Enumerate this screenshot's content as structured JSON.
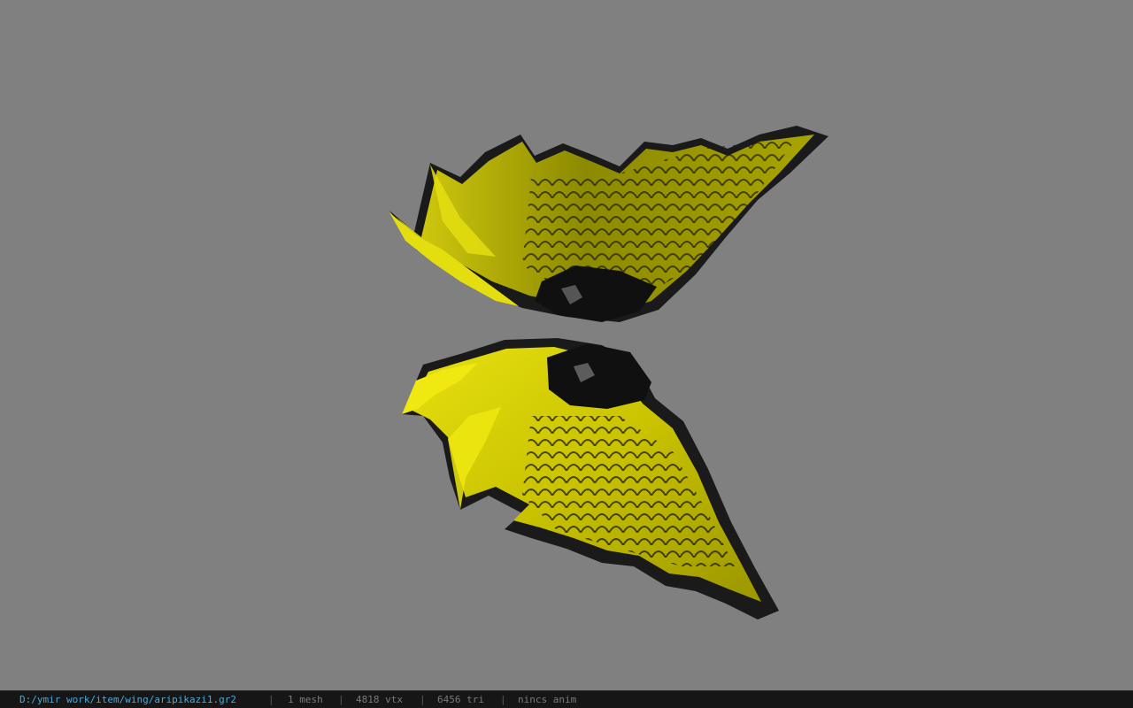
{
  "viewport": {
    "background_color": "#808080",
    "model_colors": {
      "feather": "#b8b000",
      "feather_light": "#e0dc10",
      "shadow": "#151515"
    }
  },
  "status": {
    "path": "D:/ymir work/item/wing/aripikazi1.gr2",
    "separator": "|",
    "mesh": "1 mesh",
    "vtx": "4818 vtx",
    "tri": "6456 tri",
    "anim": "nincs anim"
  }
}
